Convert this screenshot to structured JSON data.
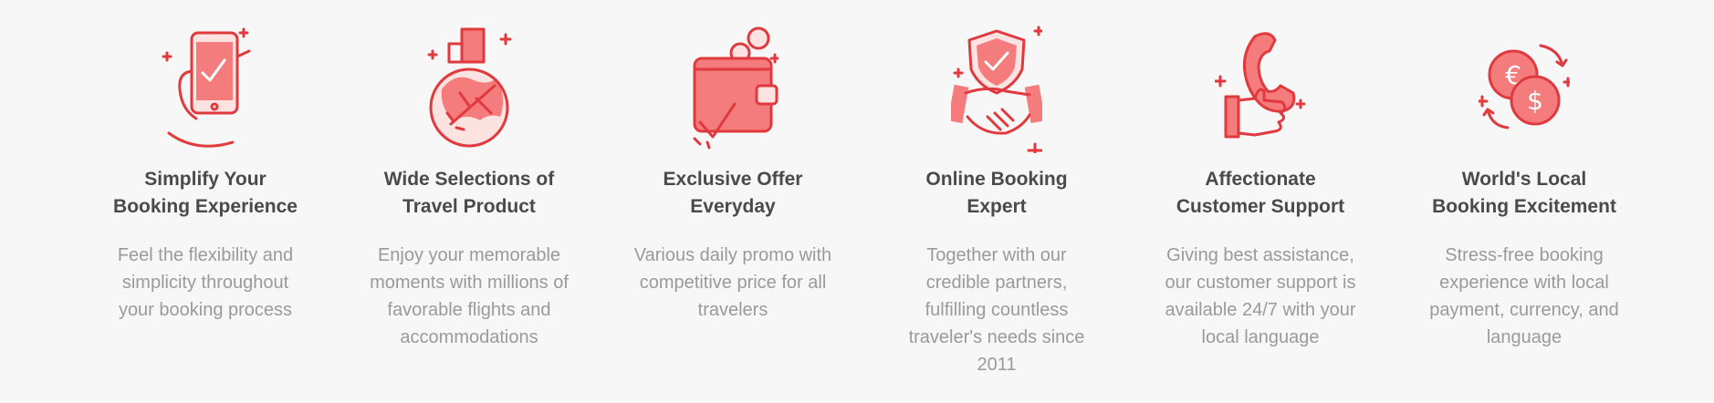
{
  "features": [
    {
      "icon": "phone-check-icon",
      "title_line1": "Simplify Your",
      "title_line2": "Booking Experience",
      "description": "Feel the flexibility and simplicity throughout your booking process"
    },
    {
      "icon": "globe-plane-icon",
      "title_line1": "Wide Selections of",
      "title_line2": "Travel Product",
      "description": "Enjoy your memorable moments with millions of favorable flights and accommodations"
    },
    {
      "icon": "wallet-coins-icon",
      "title_line1": "Exclusive Offer",
      "title_line2": "Everyday",
      "description": "Various daily promo with competitive price for all travelers"
    },
    {
      "icon": "handshake-shield-icon",
      "title_line1": "Online Booking",
      "title_line2": "Expert",
      "description": "Together with our credible partners, fulfilling countless traveler's needs since 2011"
    },
    {
      "icon": "phone-thumbs-up-icon",
      "title_line1": "Affectionate",
      "title_line2": "Customer Support",
      "description": "Giving best assistance, our customer support is available 24/7 with your local language"
    },
    {
      "icon": "currency-exchange-icon",
      "title_line1": "World's Local",
      "title_line2": "Booking Excitement",
      "description": "Stress-free booking experience with local payment, currency, and language"
    }
  ],
  "colors": {
    "accent": "#e0393e",
    "accent_light": "#f47c7c",
    "title": "#4a4a4a",
    "description": "#9a9a9a",
    "background": "#f7f7f7"
  }
}
